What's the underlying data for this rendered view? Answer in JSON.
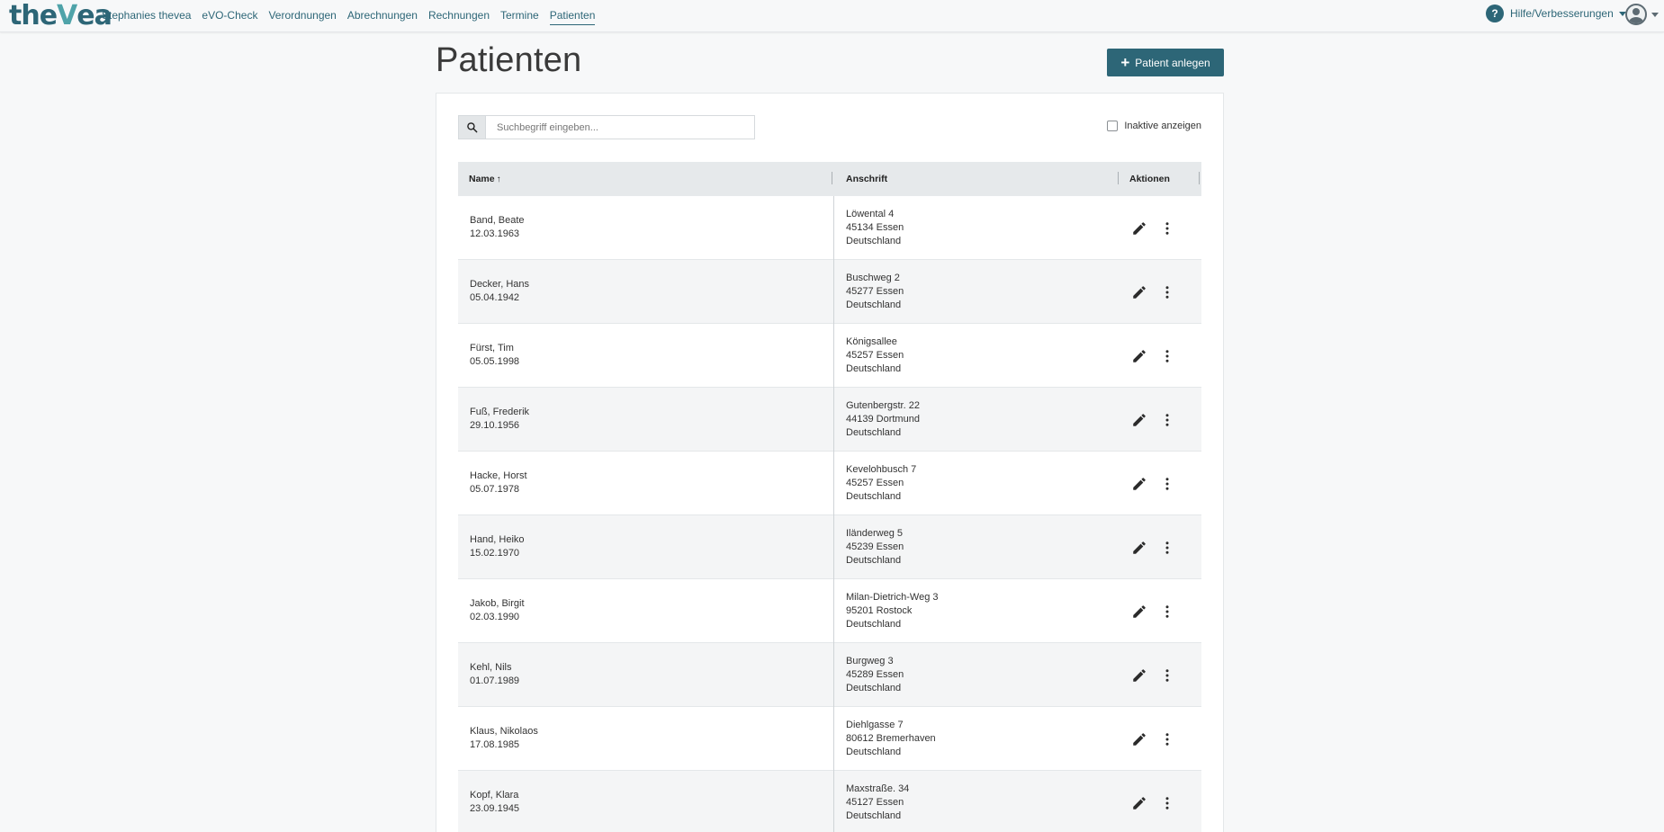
{
  "brand": {
    "logo_prefix": "the",
    "logo_v": "V",
    "logo_suffix": "ea"
  },
  "nav": {
    "items": [
      {
        "label": "Stephanies thevea"
      },
      {
        "label": "eVO-Check"
      },
      {
        "label": "Verordnungen"
      },
      {
        "label": "Abrechnungen"
      },
      {
        "label": "Rechnungen"
      },
      {
        "label": "Termine"
      },
      {
        "label": "Patienten",
        "active": true
      }
    ],
    "help_icon": "?",
    "help_label": "Hilfe/Verbesserungen",
    "avatar_icon": "user-avatar-icon"
  },
  "page": {
    "title": "Patienten",
    "add_button_label": "Patient anlegen",
    "add_button_icon": "+"
  },
  "filters": {
    "search_placeholder": "Suchbegriff eingeben...",
    "search_value": "",
    "inactive_label": "Inaktive anzeigen",
    "inactive_checked": false
  },
  "table": {
    "columns": {
      "name": "Name",
      "address": "Anschrift",
      "actions": "Aktionen"
    },
    "sort_indicator": "↑",
    "rows": [
      {
        "name": "Band, Beate",
        "dob": "12.03.1963",
        "street": "Löwental 4",
        "city": "45134 Essen",
        "country": "Deutschland"
      },
      {
        "name": "Decker, Hans",
        "dob": "05.04.1942",
        "street": "Buschweg 2",
        "city": "45277 Essen",
        "country": "Deutschland"
      },
      {
        "name": "Fürst, Tim",
        "dob": "05.05.1998",
        "street": "Königsallee",
        "city": "45257 Essen",
        "country": "Deutschland"
      },
      {
        "name": "Fuß, Frederik",
        "dob": "29.10.1956",
        "street": "Gutenbergstr. 22",
        "city": "44139 Dortmund",
        "country": "Deutschland"
      },
      {
        "name": "Hacke, Horst",
        "dob": "05.07.1978",
        "street": "Kevelohbusch 7",
        "city": "45257 Essen",
        "country": "Deutschland"
      },
      {
        "name": "Hand, Heiko",
        "dob": "15.02.1970",
        "street": "Iländerweg 5",
        "city": "45239 Essen",
        "country": "Deutschland"
      },
      {
        "name": "Jakob, Birgit",
        "dob": "02.03.1990",
        "street": "Milan-Dietrich-Weg 3",
        "city": "95201 Rostock",
        "country": "Deutschland"
      },
      {
        "name": "Kehl, Nils",
        "dob": "01.07.1989",
        "street": "Burgweg 3",
        "city": "45289 Essen",
        "country": "Deutschland"
      },
      {
        "name": "Klaus, Nikolaos",
        "dob": "17.08.1985",
        "street": "Diehlgasse 7",
        "city": "80612 Bremerhaven",
        "country": "Deutschland"
      },
      {
        "name": "Kopf, Klara",
        "dob": "23.09.1945",
        "street": "Maxstraße. 34",
        "city": "45127 Essen",
        "country": "Deutschland"
      }
    ]
  },
  "colors": {
    "brand": "#2d6677",
    "accent": "#4fa3a9",
    "header_bg": "#e6e9eb",
    "alt_row": "#f4f5f6"
  }
}
